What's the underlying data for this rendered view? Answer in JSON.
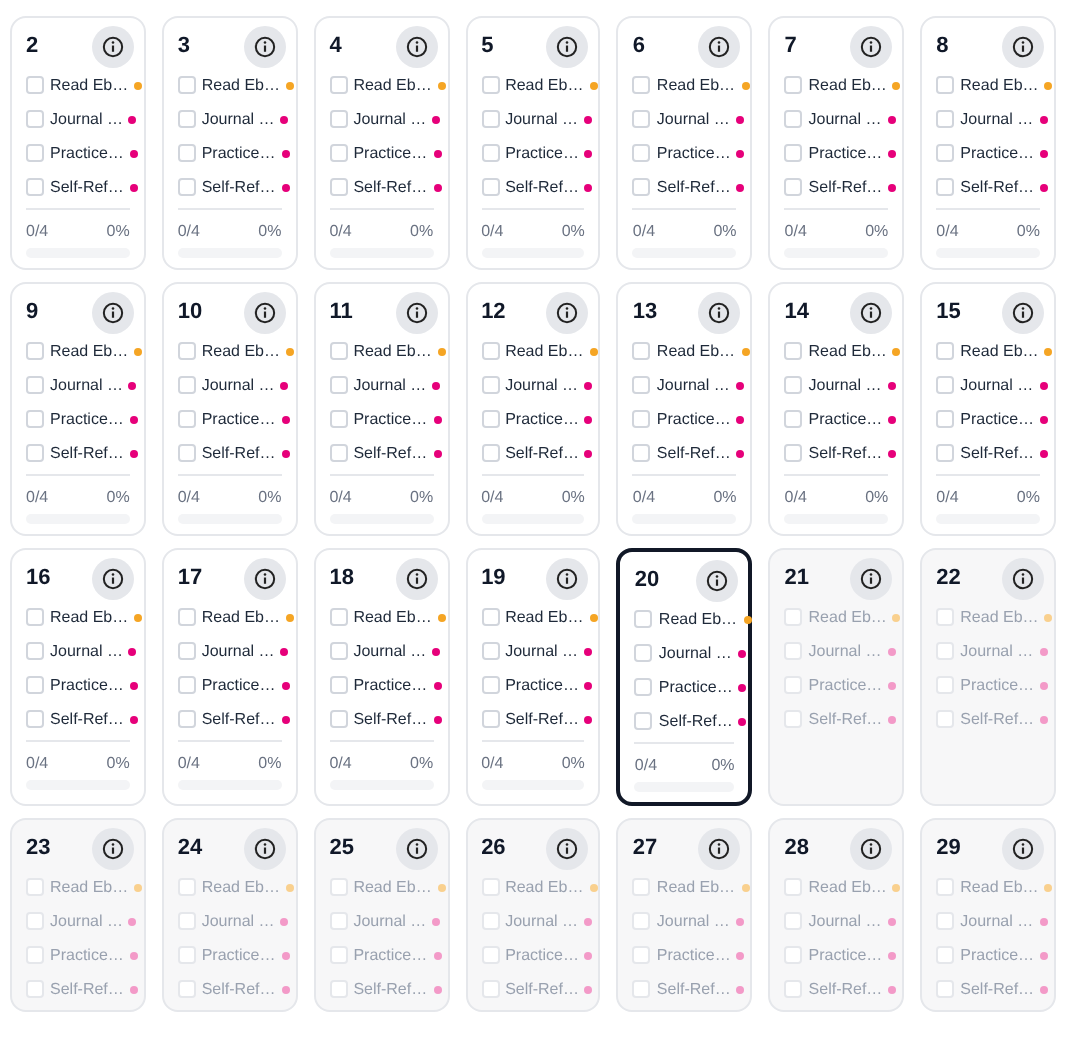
{
  "days": [
    {
      "day": "2",
      "selected": false,
      "future": false,
      "tasks": [
        {
          "label": "Read Eb…",
          "checked": false,
          "color": "#f5a524"
        },
        {
          "label": "Journal …",
          "checked": false,
          "color": "#e6007a"
        },
        {
          "label": "Practice…",
          "checked": false,
          "color": "#e6007a"
        },
        {
          "label": "Self-Ref…",
          "checked": false,
          "color": "#e6007a"
        }
      ],
      "count": "0/4",
      "percent": "0%",
      "level": 0
    },
    {
      "day": "3",
      "selected": false,
      "future": false,
      "tasks": [
        {
          "label": "Read Eb…",
          "checked": false,
          "color": "#f5a524"
        },
        {
          "label": "Journal …",
          "checked": false,
          "color": "#e6007a"
        },
        {
          "label": "Practice…",
          "checked": false,
          "color": "#e6007a"
        },
        {
          "label": "Self-Ref…",
          "checked": false,
          "color": "#e6007a"
        }
      ],
      "count": "0/4",
      "percent": "0%",
      "level": 0
    },
    {
      "day": "4",
      "selected": false,
      "future": false,
      "tasks": [
        {
          "label": "Read Eb…",
          "checked": false,
          "color": "#f5a524"
        },
        {
          "label": "Journal …",
          "checked": false,
          "color": "#e6007a"
        },
        {
          "label": "Practice…",
          "checked": false,
          "color": "#e6007a"
        },
        {
          "label": "Self-Ref…",
          "checked": false,
          "color": "#e6007a"
        }
      ],
      "count": "0/4",
      "percent": "0%",
      "level": 0
    },
    {
      "day": "5",
      "selected": false,
      "future": false,
      "tasks": [
        {
          "label": "Read Eb…",
          "checked": false,
          "color": "#f5a524"
        },
        {
          "label": "Journal …",
          "checked": false,
          "color": "#e6007a"
        },
        {
          "label": "Practice…",
          "checked": false,
          "color": "#e6007a"
        },
        {
          "label": "Self-Ref…",
          "checked": false,
          "color": "#e6007a"
        }
      ],
      "count": "0/4",
      "percent": "0%",
      "level": 0
    },
    {
      "day": "6",
      "selected": false,
      "future": false,
      "tasks": [
        {
          "label": "Read Eb…",
          "checked": false,
          "color": "#f5a524"
        },
        {
          "label": "Journal …",
          "checked": false,
          "color": "#e6007a"
        },
        {
          "label": "Practice…",
          "checked": false,
          "color": "#e6007a"
        },
        {
          "label": "Self-Ref…",
          "checked": false,
          "color": "#e6007a"
        }
      ],
      "count": "0/4",
      "percent": "0%",
      "level": 0
    },
    {
      "day": "7",
      "selected": false,
      "future": false,
      "tasks": [
        {
          "label": "Read Eb…",
          "checked": false,
          "color": "#f5a524"
        },
        {
          "label": "Journal …",
          "checked": false,
          "color": "#e6007a"
        },
        {
          "label": "Practice…",
          "checked": false,
          "color": "#e6007a"
        },
        {
          "label": "Self-Ref…",
          "checked": false,
          "color": "#e6007a"
        }
      ],
      "count": "0/4",
      "percent": "0%",
      "level": 0
    },
    {
      "day": "8",
      "selected": false,
      "future": false,
      "tasks": [
        {
          "label": "Read Eb…",
          "checked": false,
          "color": "#f5a524"
        },
        {
          "label": "Journal …",
          "checked": false,
          "color": "#e6007a"
        },
        {
          "label": "Practice…",
          "checked": false,
          "color": "#e6007a"
        },
        {
          "label": "Self-Ref…",
          "checked": false,
          "color": "#e6007a"
        }
      ],
      "count": "0/4",
      "percent": "0%",
      "level": 0
    },
    {
      "day": "9",
      "selected": false,
      "future": false,
      "tasks": [
        {
          "label": "Read Eb…",
          "checked": false,
          "color": "#f5a524"
        },
        {
          "label": "Journal …",
          "checked": false,
          "color": "#e6007a"
        },
        {
          "label": "Practice…",
          "checked": false,
          "color": "#e6007a"
        },
        {
          "label": "Self-Ref…",
          "checked": false,
          "color": "#e6007a"
        }
      ],
      "count": "0/4",
      "percent": "0%",
      "level": 0
    },
    {
      "day": "10",
      "selected": false,
      "future": false,
      "tasks": [
        {
          "label": "Read Eb…",
          "checked": false,
          "color": "#f5a524"
        },
        {
          "label": "Journal …",
          "checked": false,
          "color": "#e6007a"
        },
        {
          "label": "Practice…",
          "checked": false,
          "color": "#e6007a"
        },
        {
          "label": "Self-Ref…",
          "checked": false,
          "color": "#e6007a"
        }
      ],
      "count": "0/4",
      "percent": "0%",
      "level": 0
    },
    {
      "day": "11",
      "selected": false,
      "future": false,
      "tasks": [
        {
          "label": "Read Eb…",
          "checked": false,
          "color": "#f5a524"
        },
        {
          "label": "Journal …",
          "checked": false,
          "color": "#e6007a"
        },
        {
          "label": "Practice…",
          "checked": false,
          "color": "#e6007a"
        },
        {
          "label": "Self-Ref…",
          "checked": false,
          "color": "#e6007a"
        }
      ],
      "count": "0/4",
      "percent": "0%",
      "level": 0
    },
    {
      "day": "12",
      "selected": false,
      "future": false,
      "tasks": [
        {
          "label": "Read Eb…",
          "checked": false,
          "color": "#f5a524"
        },
        {
          "label": "Journal …",
          "checked": false,
          "color": "#e6007a"
        },
        {
          "label": "Practice…",
          "checked": false,
          "color": "#e6007a"
        },
        {
          "label": "Self-Ref…",
          "checked": false,
          "color": "#e6007a"
        }
      ],
      "count": "0/4",
      "percent": "0%",
      "level": 0
    },
    {
      "day": "13",
      "selected": false,
      "future": false,
      "tasks": [
        {
          "label": "Read Eb…",
          "checked": false,
          "color": "#f5a524"
        },
        {
          "label": "Journal …",
          "checked": false,
          "color": "#e6007a"
        },
        {
          "label": "Practice…",
          "checked": false,
          "color": "#e6007a"
        },
        {
          "label": "Self-Ref…",
          "checked": false,
          "color": "#e6007a"
        }
      ],
      "count": "0/4",
      "percent": "0%",
      "level": 0
    },
    {
      "day": "14",
      "selected": false,
      "future": false,
      "tasks": [
        {
          "label": "Read Eb…",
          "checked": false,
          "color": "#f5a524"
        },
        {
          "label": "Journal …",
          "checked": false,
          "color": "#e6007a"
        },
        {
          "label": "Practice…",
          "checked": false,
          "color": "#e6007a"
        },
        {
          "label": "Self-Ref…",
          "checked": false,
          "color": "#e6007a"
        }
      ],
      "count": "0/4",
      "percent": "0%",
      "level": 0
    },
    {
      "day": "15",
      "selected": false,
      "future": false,
      "tasks": [
        {
          "label": "Read Eb…",
          "checked": false,
          "color": "#f5a524"
        },
        {
          "label": "Journal …",
          "checked": false,
          "color": "#e6007a"
        },
        {
          "label": "Practice…",
          "checked": false,
          "color": "#e6007a"
        },
        {
          "label": "Self-Ref…",
          "checked": false,
          "color": "#e6007a"
        }
      ],
      "count": "0/4",
      "percent": "0%",
      "level": 0
    },
    {
      "day": "16",
      "selected": false,
      "future": false,
      "tasks": [
        {
          "label": "Read Eb…",
          "checked": false,
          "color": "#f5a524"
        },
        {
          "label": "Journal …",
          "checked": false,
          "color": "#e6007a"
        },
        {
          "label": "Practice…",
          "checked": false,
          "color": "#e6007a"
        },
        {
          "label": "Self-Ref…",
          "checked": false,
          "color": "#e6007a"
        }
      ],
      "count": "0/4",
      "percent": "0%",
      "level": 0
    },
    {
      "day": "17",
      "selected": false,
      "future": false,
      "tasks": [
        {
          "label": "Read Eb…",
          "checked": false,
          "color": "#f5a524"
        },
        {
          "label": "Journal …",
          "checked": false,
          "color": "#e6007a"
        },
        {
          "label": "Practice…",
          "checked": false,
          "color": "#e6007a"
        },
        {
          "label": "Self-Ref…",
          "checked": false,
          "color": "#e6007a"
        }
      ],
      "count": "0/4",
      "percent": "0%",
      "level": 0
    },
    {
      "day": "18",
      "selected": false,
      "future": false,
      "tasks": [
        {
          "label": "Read Eb…",
          "checked": false,
          "color": "#f5a524"
        },
        {
          "label": "Journal …",
          "checked": false,
          "color": "#e6007a"
        },
        {
          "label": "Practice…",
          "checked": false,
          "color": "#e6007a"
        },
        {
          "label": "Self-Ref…",
          "checked": false,
          "color": "#e6007a"
        }
      ],
      "count": "0/4",
      "percent": "0%",
      "level": 0
    },
    {
      "day": "19",
      "selected": false,
      "future": false,
      "tasks": [
        {
          "label": "Read Eb…",
          "checked": false,
          "color": "#f5a524"
        },
        {
          "label": "Journal …",
          "checked": false,
          "color": "#e6007a"
        },
        {
          "label": "Practice…",
          "checked": false,
          "color": "#e6007a"
        },
        {
          "label": "Self-Ref…",
          "checked": false,
          "color": "#e6007a"
        }
      ],
      "count": "0/4",
      "percent": "0%",
      "level": 0
    },
    {
      "day": "20",
      "selected": true,
      "future": false,
      "tasks": [
        {
          "label": "Read Eb…",
          "checked": false,
          "color": "#f5a524"
        },
        {
          "label": "Journal …",
          "checked": false,
          "color": "#e6007a"
        },
        {
          "label": "Practice…",
          "checked": false,
          "color": "#e6007a"
        },
        {
          "label": "Self-Ref…",
          "checked": false,
          "color": "#e6007a"
        }
      ],
      "count": "0/4",
      "percent": "0%",
      "level": 0
    },
    {
      "day": "21",
      "selected": false,
      "future": true,
      "tasks": [
        {
          "label": "Read Eb…",
          "checked": false,
          "color": "#f9d08e"
        },
        {
          "label": "Journal …",
          "checked": false,
          "color": "#f39ac8"
        },
        {
          "label": "Practice…",
          "checked": false,
          "color": "#f39ac8"
        },
        {
          "label": "Self-Ref…",
          "checked": false,
          "color": "#f39ac8"
        }
      ]
    },
    {
      "day": "22",
      "selected": false,
      "future": true,
      "tasks": [
        {
          "label": "Read Eb…",
          "checked": false,
          "color": "#f9d08e"
        },
        {
          "label": "Journal …",
          "checked": false,
          "color": "#f39ac8"
        },
        {
          "label": "Practice…",
          "checked": false,
          "color": "#f39ac8"
        },
        {
          "label": "Self-Ref…",
          "checked": false,
          "color": "#f39ac8"
        }
      ]
    },
    {
      "day": "23",
      "selected": false,
      "future": true,
      "tasks": [
        {
          "label": "Read Eb…",
          "checked": false,
          "color": "#f9d08e"
        },
        {
          "label": "Journal …",
          "checked": false,
          "color": "#f39ac8"
        },
        {
          "label": "Practice…",
          "checked": false,
          "color": "#f39ac8"
        },
        {
          "label": "Self-Ref…",
          "checked": false,
          "color": "#f39ac8"
        }
      ]
    },
    {
      "day": "24",
      "selected": false,
      "future": true,
      "tasks": [
        {
          "label": "Read Eb…",
          "checked": false,
          "color": "#f9d08e"
        },
        {
          "label": "Journal …",
          "checked": false,
          "color": "#f39ac8"
        },
        {
          "label": "Practice…",
          "checked": false,
          "color": "#f39ac8"
        },
        {
          "label": "Self-Ref…",
          "checked": false,
          "color": "#f39ac8"
        }
      ]
    },
    {
      "day": "25",
      "selected": false,
      "future": true,
      "tasks": [
        {
          "label": "Read Eb…",
          "checked": false,
          "color": "#f9d08e"
        },
        {
          "label": "Journal …",
          "checked": false,
          "color": "#f39ac8"
        },
        {
          "label": "Practice…",
          "checked": false,
          "color": "#f39ac8"
        },
        {
          "label": "Self-Ref…",
          "checked": false,
          "color": "#f39ac8"
        }
      ]
    },
    {
      "day": "26",
      "selected": false,
      "future": true,
      "tasks": [
        {
          "label": "Read Eb…",
          "checked": false,
          "color": "#f9d08e"
        },
        {
          "label": "Journal …",
          "checked": false,
          "color": "#f39ac8"
        },
        {
          "label": "Practice…",
          "checked": false,
          "color": "#f39ac8"
        },
        {
          "label": "Self-Ref…",
          "checked": false,
          "color": "#f39ac8"
        }
      ]
    },
    {
      "day": "27",
      "selected": false,
      "future": true,
      "tasks": [
        {
          "label": "Read Eb…",
          "checked": false,
          "color": "#f9d08e"
        },
        {
          "label": "Journal …",
          "checked": false,
          "color": "#f39ac8"
        },
        {
          "label": "Practice…",
          "checked": false,
          "color": "#f39ac8"
        },
        {
          "label": "Self-Ref…",
          "checked": false,
          "color": "#f39ac8"
        }
      ]
    },
    {
      "day": "28",
      "selected": false,
      "future": true,
      "tasks": [
        {
          "label": "Read Eb…",
          "checked": false,
          "color": "#f9d08e"
        },
        {
          "label": "Journal …",
          "checked": false,
          "color": "#f39ac8"
        },
        {
          "label": "Practice…",
          "checked": false,
          "color": "#f39ac8"
        },
        {
          "label": "Self-Ref…",
          "checked": false,
          "color": "#f39ac8"
        }
      ]
    },
    {
      "day": "29",
      "selected": false,
      "future": true,
      "tasks": [
        {
          "label": "Read Eb…",
          "checked": false,
          "color": "#f9d08e"
        },
        {
          "label": "Journal …",
          "checked": false,
          "color": "#f39ac8"
        },
        {
          "label": "Practice…",
          "checked": false,
          "color": "#f39ac8"
        },
        {
          "label": "Self-Ref…",
          "checked": false,
          "color": "#f39ac8"
        }
      ]
    }
  ]
}
